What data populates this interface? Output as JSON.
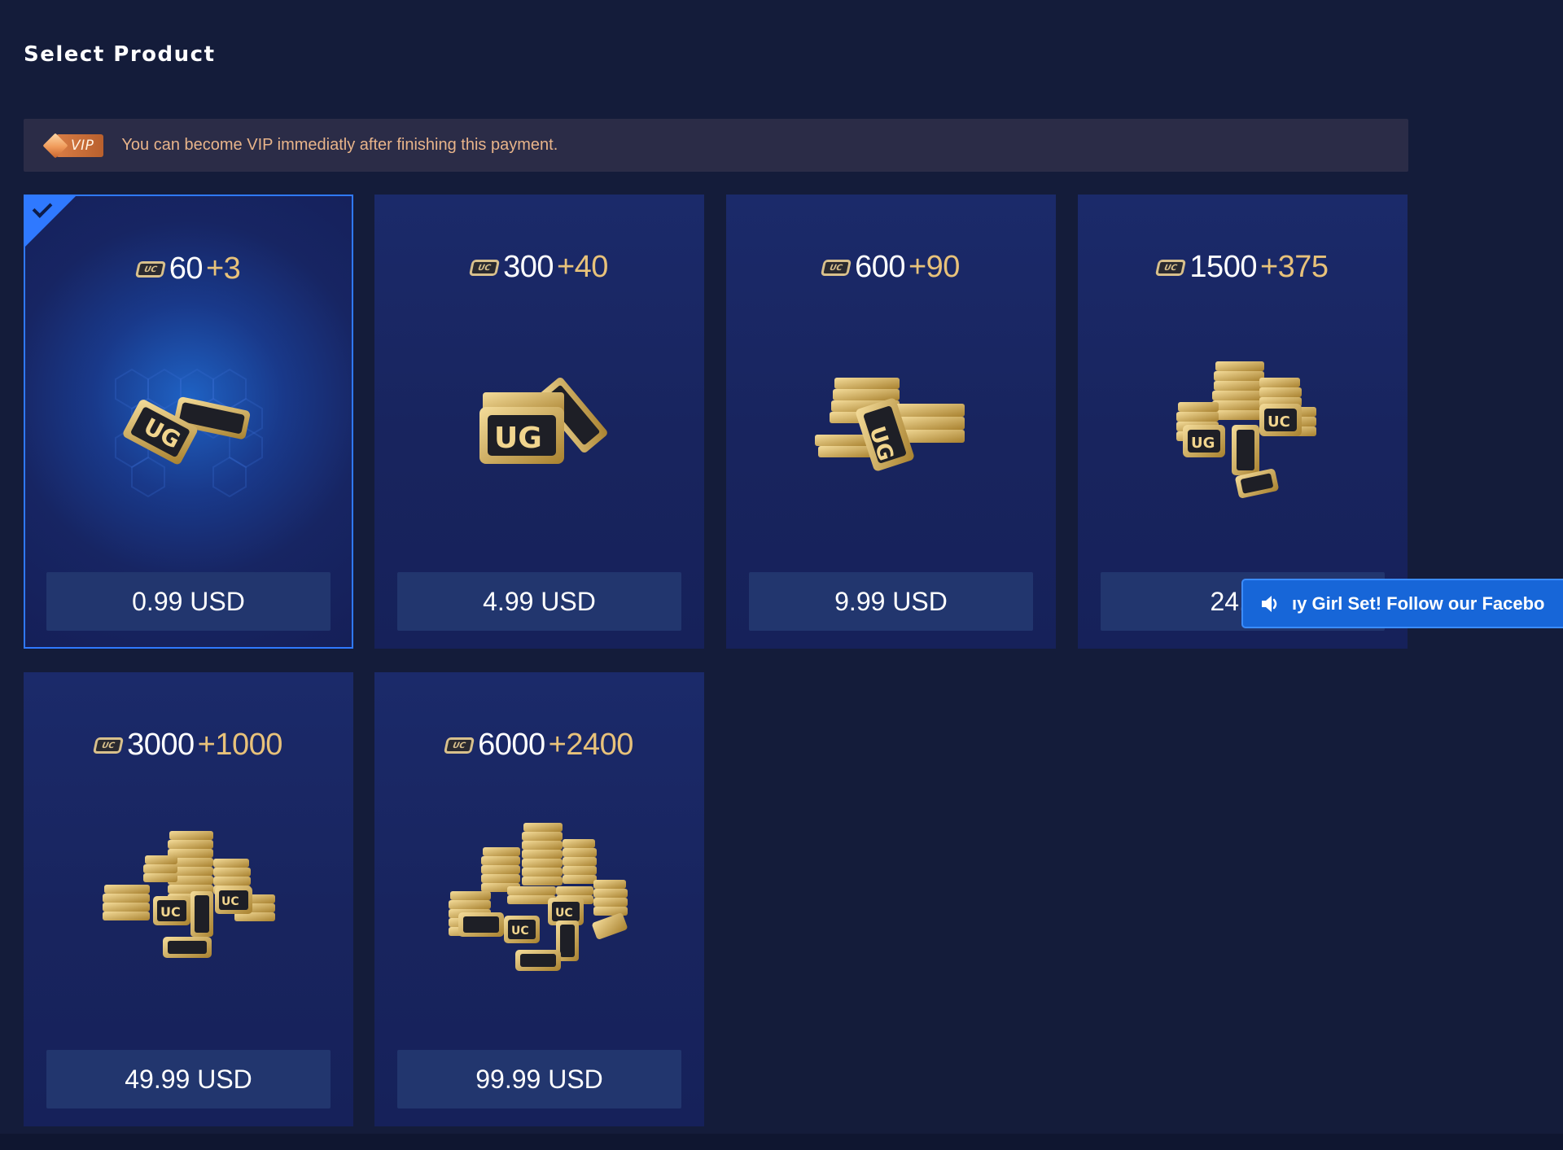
{
  "header": {
    "title": "Select Product"
  },
  "vip_banner": {
    "badge_label": "VIP",
    "message": "You can become VIP immediatly after finishing this payment.",
    "accent_color": "#e8b48a"
  },
  "currency": {
    "icon": "uc-currency-icon",
    "badge_text": "UC",
    "bonus_color": "#e8c27a"
  },
  "products": [
    {
      "base": "60",
      "bonus": "+3",
      "price": "0.99 USD",
      "selected": true
    },
    {
      "base": "300",
      "bonus": "+40",
      "price": "4.99 USD",
      "selected": false
    },
    {
      "base": "600",
      "bonus": "+90",
      "price": "9.99 USD",
      "selected": false
    },
    {
      "base": "1500",
      "bonus": "+375",
      "price": "24.99",
      "selected": false
    },
    {
      "base": "3000",
      "bonus": "+1000",
      "price": "49.99 USD",
      "selected": false
    },
    {
      "base": "6000",
      "bonus": "+2400",
      "price": "99.99 USD",
      "selected": false
    }
  ],
  "toast": {
    "icon": "speaker-icon",
    "text": "ıy Girl Set! Follow our Facebo"
  },
  "colors": {
    "background": "#141c3a",
    "card": "#1b2a6a",
    "selected_border": "#2f79ff",
    "price_button": "#22366e",
    "toast": "#1766d8"
  }
}
